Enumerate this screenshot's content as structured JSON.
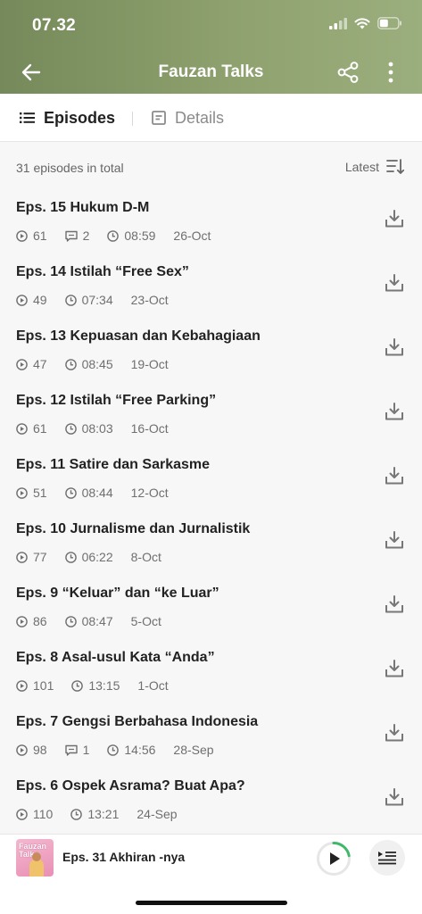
{
  "status": {
    "time": "07.32"
  },
  "header": {
    "title": "Fauzan Talks"
  },
  "tabs": [
    {
      "label": "Episodes",
      "active": true
    },
    {
      "label": "Details",
      "active": false
    }
  ],
  "list": {
    "total_label": "31 episodes in total",
    "sort_label": "Latest"
  },
  "episodes": [
    {
      "title": "Eps. 15 Hukum D-M",
      "plays": "61",
      "comments": "2",
      "duration": "08:59",
      "date": "26-Oct"
    },
    {
      "title": "Eps. 14 Istilah “Free Sex”",
      "plays": "49",
      "duration": "07:34",
      "date": "23-Oct"
    },
    {
      "title": "Eps. 13 Kepuasan dan Kebahagiaan",
      "plays": "47",
      "duration": "08:45",
      "date": "19-Oct"
    },
    {
      "title": "Eps. 12 Istilah “Free Parking”",
      "plays": "61",
      "duration": "08:03",
      "date": "16-Oct"
    },
    {
      "title": "Eps. 11 Satire dan Sarkasme",
      "plays": "51",
      "duration": "08:44",
      "date": "12-Oct"
    },
    {
      "title": "Eps. 10 Jurnalisme dan Jurnalistik",
      "plays": "77",
      "duration": "06:22",
      "date": "8-Oct"
    },
    {
      "title": "Eps. 9 “Keluar” dan “ke Luar”",
      "plays": "86",
      "duration": "08:47",
      "date": "5-Oct"
    },
    {
      "title": "Eps. 8 Asal-usul Kata “Anda”",
      "plays": "101",
      "duration": "13:15",
      "date": "1-Oct"
    },
    {
      "title": "Eps. 7 Gengsi Berbahasa Indonesia",
      "plays": "98",
      "comments": "1",
      "duration": "14:56",
      "date": "28-Sep"
    },
    {
      "title": "Eps. 6 Ospek Asrama? Buat Apa?",
      "plays": "110",
      "duration": "13:21",
      "date": "24-Sep"
    }
  ],
  "player": {
    "cover_text_line1": "Fauzan",
    "cover_text_line2": "Talks",
    "now_playing": "Eps. 31 Akhiran -nya",
    "progress": 0.22
  },
  "colors": {
    "header_start": "#75895a",
    "header_end": "#9bae7d",
    "progress": "#3fb86a"
  }
}
